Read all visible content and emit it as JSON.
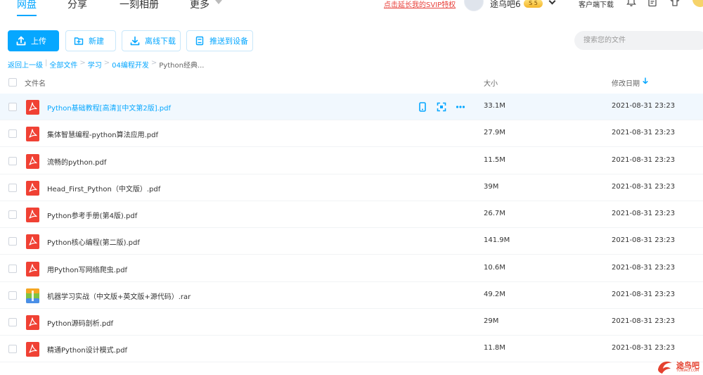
{
  "nav": {
    "tabs": [
      {
        "label": "网盘",
        "active": true
      },
      {
        "label": "分享"
      },
      {
        "label": "一刻相册"
      },
      {
        "label": "更多"
      }
    ],
    "svip_link": "点击延长我的SVIP特权",
    "username": "途乌吧6",
    "vip_badge": "S 5",
    "client_download": "客户端下载",
    "icons": [
      "bell-icon",
      "document-icon",
      "shirt-icon"
    ]
  },
  "toolbar": {
    "upload": "上传",
    "new": "新建",
    "offline_download": "离线下载",
    "push_device": "推送到设备",
    "search_placeholder": "搜索您的文件"
  },
  "breadcrumb": {
    "back": "返回上一级",
    "items": [
      "全部文件",
      "学习",
      "04编程开发"
    ],
    "current": "Python经典..."
  },
  "table": {
    "headers": {
      "name": "文件名",
      "size": "大小",
      "date": "修改日期"
    },
    "sort": "date-desc",
    "rows": [
      {
        "name": "Python基础教程[高清][中文第2版].pdf",
        "size": "33.1M",
        "date": "2021-08-31 23:23",
        "type": "pdf",
        "hover": true
      },
      {
        "name": "集体智慧编程-python算法应用.pdf",
        "size": "27.9M",
        "date": "2021-08-31 23:23",
        "type": "pdf"
      },
      {
        "name": "流畅的python.pdf",
        "size": "11.5M",
        "date": "2021-08-31 23:23",
        "type": "pdf"
      },
      {
        "name": "Head_First_Python（中文版）.pdf",
        "size": "39M",
        "date": "2021-08-31 23:23",
        "type": "pdf"
      },
      {
        "name": "Python参考手册(第4版).pdf",
        "size": "26.7M",
        "date": "2021-08-31 23:23",
        "type": "pdf"
      },
      {
        "name": "Python核心编程(第二版).pdf",
        "size": "141.9M",
        "date": "2021-08-31 23:23",
        "type": "pdf"
      },
      {
        "name": "用Python写网络爬虫.pdf",
        "size": "10.6M",
        "date": "2021-08-31 23:23",
        "type": "pdf"
      },
      {
        "name": "机器学习实战（中文版+英文版+源代码）.rar",
        "size": "49.2M",
        "date": "2021-08-31 23:23",
        "type": "rar"
      },
      {
        "name": "Python源码剖析.pdf",
        "size": "29M",
        "date": "2021-08-31 23:23",
        "type": "pdf"
      },
      {
        "name": "精通Python设计模式.pdf",
        "size": "11.8M",
        "date": "2021-08-31 23:23",
        "type": "pdf"
      }
    ],
    "row_actions": [
      "phone-icon",
      "share-icon",
      "more-icon"
    ]
  },
  "watermark": {
    "text": "途鸟吧",
    "sub": "TUNIAO.COM"
  },
  "colors": {
    "accent": "#06a7ff",
    "pdf": "#f04134",
    "link_red": "#e8413b",
    "hover_row": "#f1f8fe"
  }
}
